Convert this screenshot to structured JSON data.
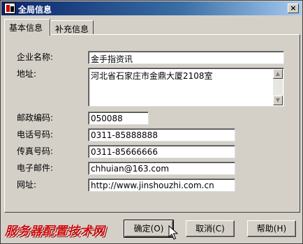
{
  "window": {
    "title": "全局信息",
    "close_glyph": "×"
  },
  "tabs": [
    {
      "label": "基本信息",
      "active": true
    },
    {
      "label": "补充信息",
      "active": false
    }
  ],
  "form": {
    "company_name": {
      "label": "企业名称:",
      "value": "金手指资讯"
    },
    "address": {
      "label": "地址:",
      "value": "河北省石家庄市金鼎大厦2108室"
    },
    "postal_code": {
      "label": "邮政编码:",
      "value": "050088"
    },
    "phone": {
      "label": "电话号码:",
      "value": "0311-85888888"
    },
    "fax": {
      "label": "传真号码:",
      "value": "0311-85666666"
    },
    "email": {
      "label": "电子邮件:",
      "value": "chhuian@163.com"
    },
    "website": {
      "label": "网址:",
      "value": "http://www.jinshouzhi.com.cn"
    }
  },
  "buttons": {
    "ok": "确定(O)",
    "cancel": "取消(C)",
    "help": "帮助(H)"
  },
  "watermark": "服务器配置技术网",
  "icons": [
    "app-icon",
    "close-icon",
    "scroll-up-icon",
    "scroll-down-icon",
    "mouse-cursor-icon"
  ],
  "colors": {
    "titlebar": "#0a246a",
    "face": "#d4d0c8",
    "watermark": "#cc1010"
  }
}
